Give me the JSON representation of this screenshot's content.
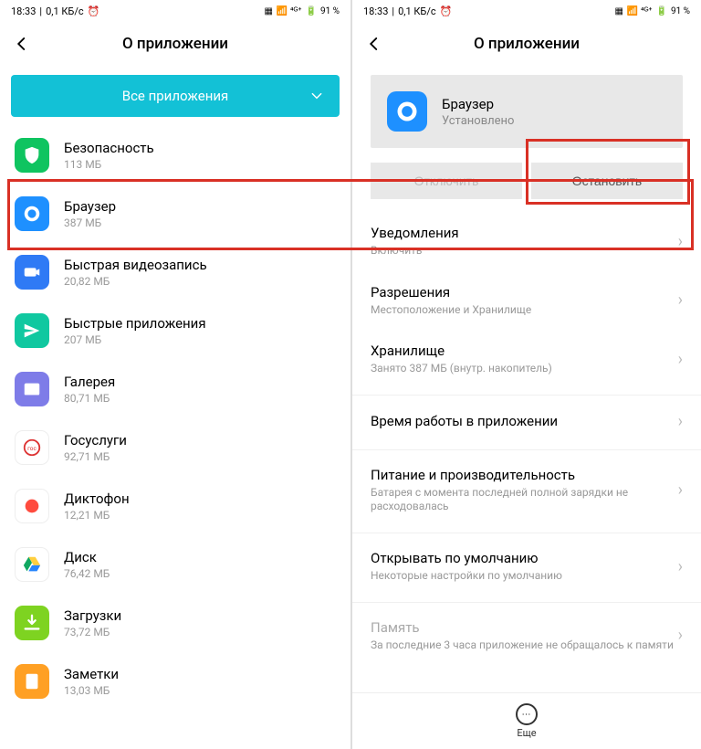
{
  "status": {
    "time": "18:33",
    "speed": "0,1 КБ/с",
    "alarm": "⏰",
    "battery_pct": "91 %"
  },
  "left": {
    "header_title": "О приложении",
    "dropdown_label": "Все приложения",
    "apps": [
      {
        "name": "Безопасность",
        "size": "113 МБ",
        "icon_bg": "#0fc460",
        "icon_fg": "#fff",
        "glyph": "shield"
      },
      {
        "name": "Браузер",
        "size": "387 МБ",
        "icon_bg": "#1e90ff",
        "icon_fg": "#fff",
        "glyph": "globe"
      },
      {
        "name": "Быстрая видеозапись",
        "size": "20,82 МБ",
        "icon_bg": "#2f7af5",
        "icon_fg": "#fff",
        "glyph": "camera"
      },
      {
        "name": "Быстрые приложения",
        "size": "207 МБ",
        "icon_bg": "#10c8a0",
        "icon_fg": "#fff",
        "glyph": "send"
      },
      {
        "name": "Галерея",
        "size": "80,71 МБ",
        "icon_bg": "#7e7ce8",
        "icon_fg": "#fff",
        "glyph": "gallery"
      },
      {
        "name": "Госуслуги",
        "size": "92,71 МБ",
        "icon_bg": "#ffffff",
        "icon_fg": "#d33",
        "glyph": "gos"
      },
      {
        "name": "Диктофон",
        "size": "12,21 МБ",
        "icon_bg": "#ffffff",
        "icon_fg": "#ff4b3e",
        "glyph": "record"
      },
      {
        "name": "Диск",
        "size": "76,42 МБ",
        "icon_bg": "#ffffff",
        "icon_fg": "#000",
        "glyph": "drive"
      },
      {
        "name": "Загрузки",
        "size": "73,72 МБ",
        "icon_bg": "#7ed321",
        "icon_fg": "#fff",
        "glyph": "download"
      },
      {
        "name": "Заметки",
        "size": "13,03 МБ",
        "icon_bg": "#ffa024",
        "icon_fg": "#fff",
        "glyph": "notes"
      }
    ]
  },
  "right": {
    "header_title": "О приложении",
    "app_name": "Браузер",
    "app_status": "Установлено",
    "btn_disable": "Отключить",
    "btn_stop": "Остановить",
    "settings": [
      {
        "title": "Уведомления",
        "sub": "Включить"
      },
      {
        "title": "Разрешения",
        "sub": "Местоположение и Хранилище"
      },
      {
        "title": "Хранилище",
        "sub": "Занято 387 МБ (внутр. накопитель)"
      },
      {
        "title": "Время работы в приложении",
        "sub": "",
        "sep": true
      },
      {
        "title": "Питание и производительность",
        "sub": "Батарея с момента последней полной зарядки не расходовалась",
        "sep": true
      },
      {
        "title": "Открывать по умолчанию",
        "sub": "Некоторые настройки по умолчанию",
        "sep": true
      },
      {
        "title": "Память",
        "sub": "За последние 3 часа приложение не обращалось к памяти",
        "dim": true,
        "sep": true
      }
    ],
    "more_label": "Еще"
  }
}
